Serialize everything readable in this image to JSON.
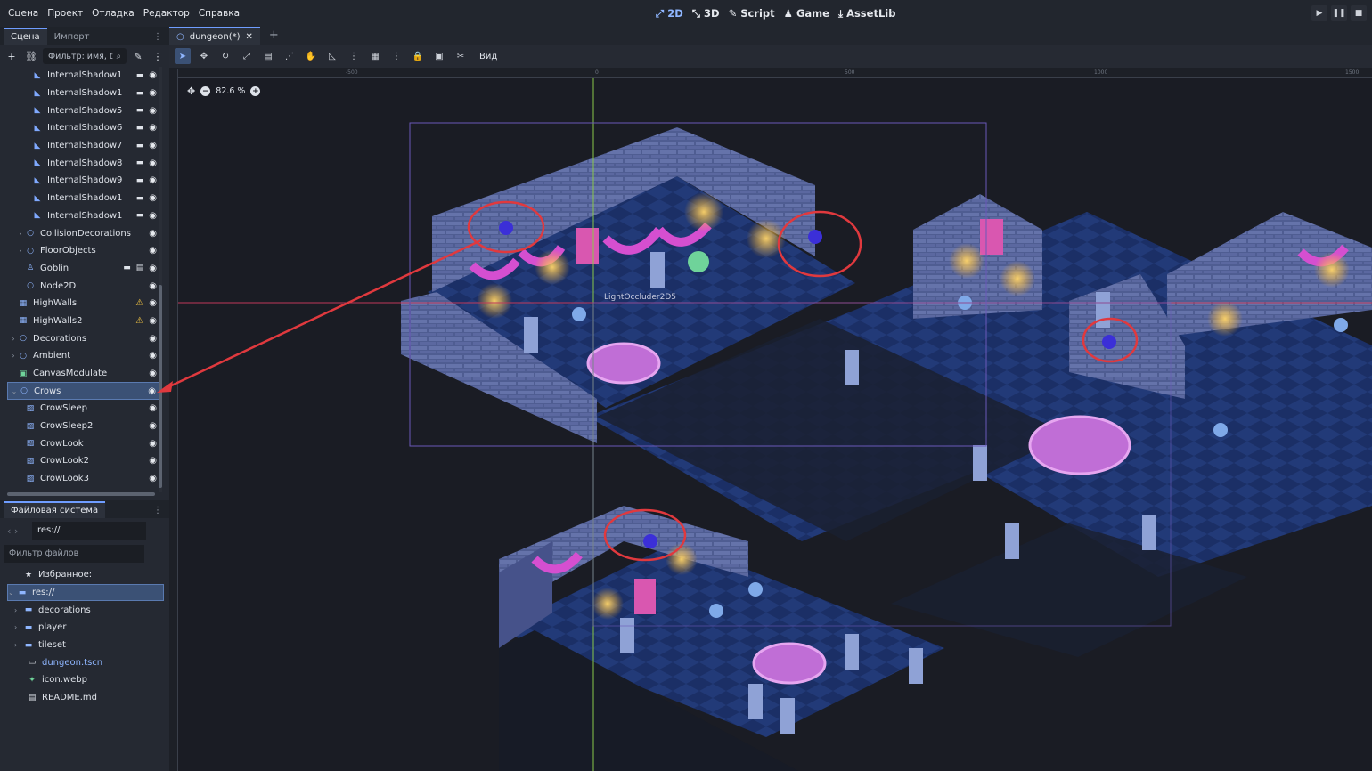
{
  "menu": [
    "Сцена",
    "Проект",
    "Отладка",
    "Редактор",
    "Справка"
  ],
  "modes": {
    "m2d": "2D",
    "m3d": "3D",
    "script": "Script",
    "game": "Game",
    "assetlib": "AssetLib"
  },
  "scene_dock": {
    "tabs": [
      "Сцена",
      "Импорт"
    ],
    "filter_placeholder": "Фильтр: имя, t",
    "nodes": [
      {
        "label": "InternalShadow1",
        "icon": "occluder-icon",
        "indent": 3
      },
      {
        "label": "InternalShadow1",
        "icon": "occluder-icon",
        "indent": 3
      },
      {
        "label": "InternalShadow5",
        "icon": "occluder-icon",
        "indent": 3
      },
      {
        "label": "InternalShadow6",
        "icon": "occluder-icon",
        "indent": 3
      },
      {
        "label": "InternalShadow7",
        "icon": "occluder-icon",
        "indent": 3
      },
      {
        "label": "InternalShadow8",
        "icon": "occluder-icon",
        "indent": 3
      },
      {
        "label": "InternalShadow9",
        "icon": "occluder-icon",
        "indent": 3
      },
      {
        "label": "InternalShadow1",
        "icon": "occluder-icon",
        "indent": 3
      },
      {
        "label": "InternalShadow1",
        "icon": "occluder-icon",
        "indent": 3
      },
      {
        "label": "CollisionDecorations",
        "icon": "node2d-icon",
        "indent": 2
      },
      {
        "label": "FloorObjects",
        "icon": "node2d-icon",
        "indent": 2
      },
      {
        "label": "Goblin",
        "icon": "character-icon",
        "indent": 2
      },
      {
        "label": "Node2D",
        "icon": "node2d-icon",
        "indent": 2
      },
      {
        "label": "HighWalls",
        "icon": "tilemap-icon",
        "indent": 1
      },
      {
        "label": "HighWalls2",
        "icon": "tilemap-icon",
        "indent": 1
      },
      {
        "label": "Decorations",
        "icon": "node2d-icon",
        "indent": 1
      },
      {
        "label": "Ambient",
        "icon": "node2d-icon",
        "indent": 1
      },
      {
        "label": "CanvasModulate",
        "icon": "canvas-modulate-icon",
        "indent": 1
      },
      {
        "label": "Crows",
        "icon": "node2d-icon",
        "indent": 1
      },
      {
        "label": "CrowSleep",
        "icon": "sprite-icon",
        "indent": 2
      },
      {
        "label": "CrowSleep2",
        "icon": "sprite-icon",
        "indent": 2
      },
      {
        "label": "CrowLook",
        "icon": "sprite-icon",
        "indent": 2
      },
      {
        "label": "CrowLook2",
        "icon": "sprite-icon",
        "indent": 2
      },
      {
        "label": "CrowLook3",
        "icon": "sprite-icon",
        "indent": 2
      }
    ]
  },
  "filesystem": {
    "title": "Файловая система",
    "path": "res://",
    "filter_placeholder": "Фильтр файлов",
    "items": [
      {
        "label": "Избранное:",
        "icon": "star-icon"
      },
      {
        "label": "res://",
        "icon": "folder-icon"
      },
      {
        "label": "decorations",
        "icon": "folder-icon"
      },
      {
        "label": "player",
        "icon": "folder-icon"
      },
      {
        "label": "tileset",
        "icon": "folder-icon"
      },
      {
        "label": "dungeon.tscn",
        "icon": "scene-icon"
      },
      {
        "label": "icon.webp",
        "icon": "image-icon"
      },
      {
        "label": "README.md",
        "icon": "text-file-icon"
      }
    ]
  },
  "viewport": {
    "scene_tab": "dungeon(*)",
    "view_menu": "Вид",
    "zoom": "82.6 %",
    "occluder_label": "LightOccluder2D5",
    "ruler_labels": [
      "-500",
      "0",
      "500",
      "1000",
      "1500"
    ]
  },
  "colors": {
    "accent": "#6f9dff",
    "selection": "#3b5175",
    "annotation": "#e0393e"
  }
}
